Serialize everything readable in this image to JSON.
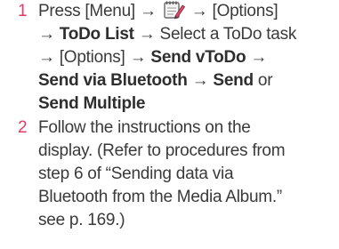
{
  "steps": [
    {
      "number": "1",
      "lines": [
        {
          "press": "Press [Menu] →",
          "icon": "notepad-pen-icon",
          "after_icon": "→ [Options]"
        },
        {
          "arrow": "→",
          "bold1": "ToDo List",
          "rest": "→ Select a ToDo task"
        },
        {
          "text": "→ [Options] →",
          "bold1": "Send vToDo",
          "arrow_end": "→"
        },
        {
          "bold1": "Send via Bluetooth",
          "mid": "→",
          "bold2": "Send",
          "rest": "or"
        },
        {
          "bold1": "Send Multiple"
        }
      ]
    },
    {
      "number": "2",
      "lines": [
        "Follow the instructions on the",
        "display. (Refer to procedures from",
        "step 6 of “Sending data via",
        "Bluetooth from the Media Album.”",
        "see p. 169.)"
      ]
    }
  ],
  "colors": {
    "step_number": "#e23b67",
    "text": "#3a3a3a"
  }
}
